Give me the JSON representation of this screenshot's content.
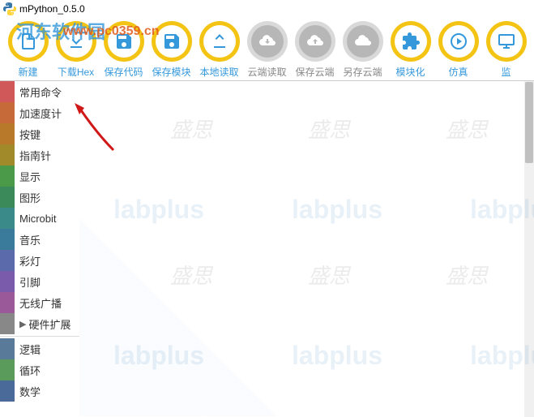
{
  "window": {
    "title": "mPython_0.5.0"
  },
  "toolbar": {
    "items": [
      {
        "label": "新建",
        "icon": "file",
        "color": "#3498db"
      },
      {
        "label": "下载Hex",
        "icon": "download",
        "color": "#3498db"
      },
      {
        "label": "保存代码",
        "icon": "save",
        "color": "#3498db"
      },
      {
        "label": "保存模块",
        "icon": "save-module",
        "color": "#3498db"
      },
      {
        "label": "本地读取",
        "icon": "upload",
        "color": "#3498db"
      },
      {
        "label": "云端读取",
        "icon": "cloud-down",
        "color": "#999",
        "grey": true
      },
      {
        "label": "保存云端",
        "icon": "cloud-up",
        "color": "#999",
        "grey": true
      },
      {
        "label": "另存云端",
        "icon": "cloud-save",
        "color": "#999",
        "grey": true
      },
      {
        "label": "模块化",
        "icon": "puzzle",
        "color": "#3498db"
      },
      {
        "label": "仿真",
        "icon": "play",
        "color": "#3498db"
      },
      {
        "label": "监",
        "icon": "monitor",
        "color": "#3498db"
      }
    ]
  },
  "categories": {
    "items": [
      {
        "label": "常用命令",
        "color": "#d05858"
      },
      {
        "label": "加速度计",
        "color": "#c76a3a"
      },
      {
        "label": "按键",
        "color": "#b87a2a"
      },
      {
        "label": "指南针",
        "color": "#a08a2a"
      },
      {
        "label": "显示",
        "color": "#4a9a4a"
      },
      {
        "label": "图形",
        "color": "#3a8a5a"
      },
      {
        "label": "Microbit",
        "color": "#3a8a8a"
      },
      {
        "label": "音乐",
        "color": "#3a7a9a"
      },
      {
        "label": "彩灯",
        "color": "#5a6aaa"
      },
      {
        "label": "引脚",
        "color": "#7a5aaa"
      },
      {
        "label": "无线广播",
        "color": "#9a5a9a"
      },
      {
        "label": "硬件扩展",
        "color": "#888",
        "expandable": true
      },
      {
        "label": "逻辑",
        "color": "#5a7a9a",
        "afterSep": true
      },
      {
        "label": "循环",
        "color": "#5a9a5a"
      },
      {
        "label": "数学",
        "color": "#4a6a9a"
      }
    ]
  },
  "watermark": {
    "site_name": "河东软件园",
    "url": "www.pc0359.cn",
    "brand1": "labplus",
    "brand2": "盛思"
  }
}
